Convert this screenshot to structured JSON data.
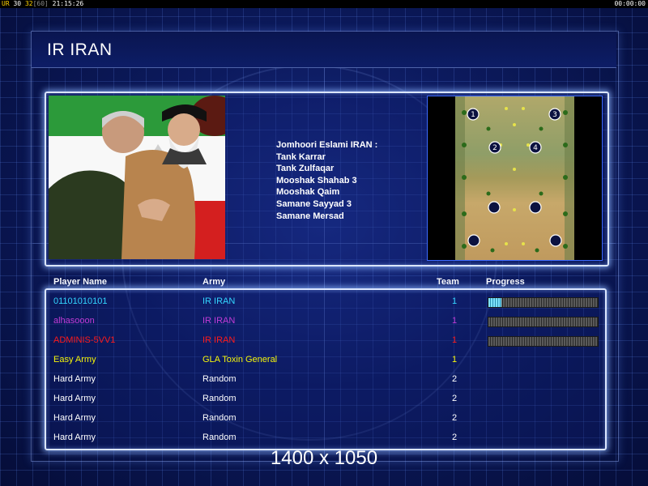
{
  "topbar": {
    "left_prefix": "UR",
    "left_a": "30",
    "left_b": "32",
    "left_c": "[60]",
    "left_time": "21:15:26",
    "right_time": "00:00:00"
  },
  "title": "IR IRAN",
  "info_lines": [
    "Jomhoori Eslami IRAN :",
    "Tank Karrar",
    "Tank Zulfaqar",
    "Mooshak Shahab 3",
    "Mooshak Qaim",
    "Samane Sayyad 3",
    "Samane Mersad"
  ],
  "map": {
    "start_positions": [
      "1",
      "3",
      "2",
      "4"
    ]
  },
  "table": {
    "headers": {
      "player": "Player Name",
      "army": "Army",
      "team": "Team",
      "progress": "Progress"
    },
    "rows": [
      {
        "name": "01101010101",
        "army": "IR IRAN",
        "team": "1",
        "color": "#33d6ff",
        "progress": 0.12
      },
      {
        "name": "alhasooon",
        "army": "IR IRAN",
        "team": "1",
        "color": "#c23bd6",
        "progress": 0.0
      },
      {
        "name": "ADMINIS-5VV1",
        "army": "IR IRAN",
        "team": "1",
        "color": "#ff1a1a",
        "progress": 0.0
      },
      {
        "name": "Easy Army",
        "army": "GLA Toxin General",
        "team": "1",
        "color": "#f5f50a"
      },
      {
        "name": "Hard Army",
        "army": "Random",
        "team": "2",
        "color": "#ffffff"
      },
      {
        "name": "Hard Army",
        "army": "Random",
        "team": "2",
        "color": "#ffffff"
      },
      {
        "name": "Hard Army",
        "army": "Random",
        "team": "2",
        "color": "#ffffff"
      },
      {
        "name": "Hard Army",
        "army": "Random",
        "team": "2",
        "color": "#ffffff"
      }
    ]
  },
  "resolution_label": "1400 x 1050"
}
